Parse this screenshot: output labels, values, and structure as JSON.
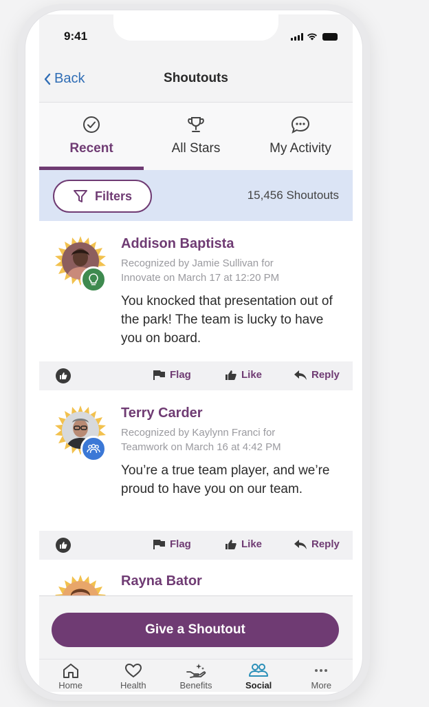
{
  "status_bar": {
    "time": "9:41"
  },
  "nav": {
    "back_label": "Back",
    "title": "Shoutouts"
  },
  "tabs": [
    {
      "label": "Recent",
      "icon": "check-circle-icon",
      "active": true
    },
    {
      "label": "All Stars",
      "icon": "trophy-icon",
      "active": false
    },
    {
      "label": "My Activity",
      "icon": "chat-bubble-icon",
      "active": false
    }
  ],
  "filters": {
    "button_label": "Filters",
    "count_text": "15,456 Shoutouts"
  },
  "shoutouts": [
    {
      "name": "Addison Baptista",
      "meta_line1": "Recognized by Jamie Sullivan for",
      "meta_line2": "Innovate on March 17 at 12:20 PM",
      "message": "You knocked that presentation out of the park! The team is lucky to have you on board.",
      "badge_icon": "lightbulb-icon",
      "badge_color": "#3e8a4f"
    },
    {
      "name": "Terry Carder",
      "meta_line1": "Recognized by Kaylynn Franci for",
      "meta_line2": "Teamwork on March 16 at 4:42 PM",
      "message": "You’re a true team player, and we’re proud to have you on our team.",
      "badge_icon": "team-icon",
      "badge_color": "#3b78d6"
    },
    {
      "name": "Rayna Bator"
    }
  ],
  "card_actions": {
    "flag": "Flag",
    "like": "Like",
    "reply": "Reply"
  },
  "cta": {
    "label": "Give a Shoutout"
  },
  "bottom_nav": [
    {
      "label": "Home",
      "icon": "home-icon",
      "active": false
    },
    {
      "label": "Health",
      "icon": "heart-icon",
      "active": false
    },
    {
      "label": "Benefits",
      "icon": "hand-sparkle-icon",
      "active": false
    },
    {
      "label": "Social",
      "icon": "people-icon",
      "active": true
    },
    {
      "label": "More",
      "icon": "more-dots-icon",
      "active": false
    }
  ],
  "colors": {
    "brand_purple": "#6f3b73",
    "link_blue": "#2f6db5",
    "filter_bar_bg": "#dbe4f5",
    "social_accent": "#2a8fb8",
    "burst_gold": "#f2c14e"
  }
}
